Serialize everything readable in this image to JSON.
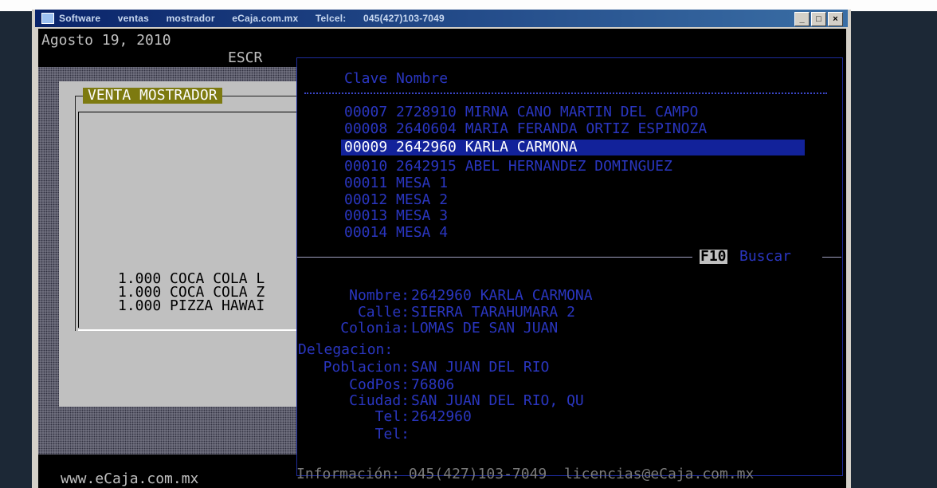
{
  "window": {
    "title_app": "Software ventas mostrador",
    "title_site": "eCaja.com.mx",
    "title_phone": "Telcel: 045(427)103-7049",
    "btn_minimize": "_",
    "btn_maximize": "□",
    "btn_close": "×"
  },
  "console": {
    "date": "Agosto 19, 2010",
    "screen_label": "ESCR"
  },
  "sale": {
    "title": "VENTA MOSTRADOR",
    "items": [
      "1.000 COCA COLA L",
      "1.000 COCA COLA Z",
      "1.000 PIZZA HAWAI"
    ]
  },
  "customer_list": {
    "header": "Clave Nombre",
    "rows": [
      "00007 2728910 MIRNA CANO MARTIN DEL CAMPO",
      "00008 2640604 MARIA FERANDA ORTIZ ESPINOZA",
      "00009 2642960 KARLA CARMONA",
      "00010 2642915 ABEL HERNANDEZ DOMINGUEZ",
      "00011 MESA 1",
      "00012 MESA 2",
      "00013 MESA 3",
      "00014 MESA 4"
    ],
    "selected_index": 2,
    "search_key": "F10",
    "search_label": "Buscar"
  },
  "customer_detail": {
    "fields": [
      {
        "label": "Nombre:",
        "value": "2642960 KARLA CARMONA"
      },
      {
        "label": "Calle:",
        "value": "SIERRA TARAHUMARA 2"
      },
      {
        "label": "Colonia:",
        "value": "LOMAS DE SAN JUAN"
      },
      {
        "label": "Delegacion:",
        "value": ""
      },
      {
        "label": "Poblacion:",
        "value": "SAN JUAN DEL RIO"
      },
      {
        "label": "CodPos:",
        "value": "76806"
      },
      {
        "label": "Ciudad:",
        "value": "SAN JUAN DEL RIO, QU"
      },
      {
        "label": "Tel:",
        "value": "2642960"
      },
      {
        "label": "Tel:",
        "value": ""
      }
    ]
  },
  "footer": {
    "website": "www.eCaja.com.mx",
    "info": "Información: 045(427)103-7049  licencias@eCaja.com.mx"
  },
  "colors": {
    "console_bg": "#000000",
    "list_text": "#2a36c0",
    "selection_bg": "#12229a",
    "title_badge": "#7d7a10"
  }
}
